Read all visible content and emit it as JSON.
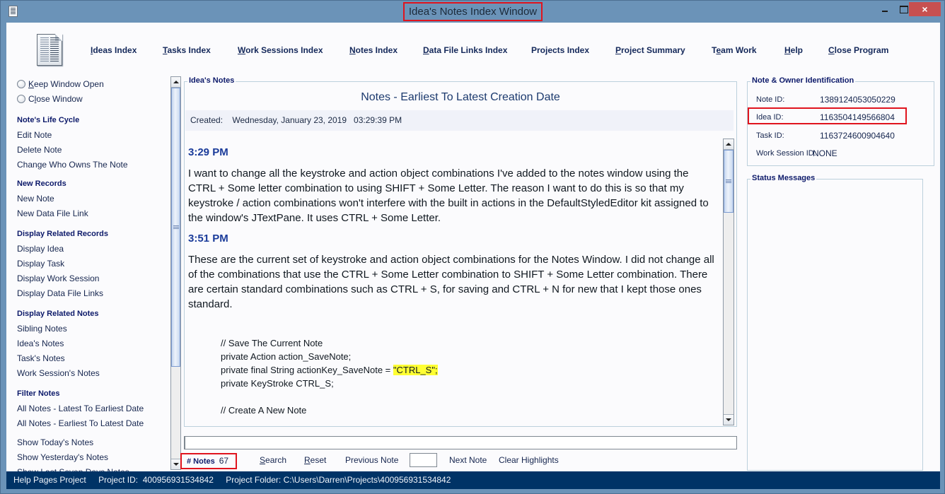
{
  "window": {
    "title": "Idea's Notes Index Window",
    "controls": {
      "minimize": "minimize",
      "maximize": "maximize",
      "close": "×"
    }
  },
  "menu": [
    {
      "label": "Ideas Index",
      "mnemonic": "I",
      "rest": "deas Index"
    },
    {
      "label": "Tasks Index",
      "mnemonic": "T",
      "rest": "asks Index"
    },
    {
      "label": "Work Sessions Index",
      "mnemonic": "W",
      "rest": "ork Sessions Index"
    },
    {
      "label": "Notes Index",
      "mnemonic": "N",
      "rest": "otes Index"
    },
    {
      "label": "Data File Links Index",
      "mnemonic": "D",
      "rest": "ata File Links Index"
    },
    {
      "label": "Projects Index",
      "mnemonic": "",
      "rest": "Projects Index"
    },
    {
      "label": "Project Summary",
      "mnemonic": "P",
      "rest": "roject Summary"
    },
    {
      "label": "Team Work",
      "pre": "T",
      "mnemonic": "e",
      "rest": "am Work"
    },
    {
      "label": "Help",
      "mnemonic": "H",
      "rest": "elp"
    },
    {
      "label": "Close Program",
      "mnemonic": "C",
      "rest": "lose Program"
    }
  ],
  "sidebar": {
    "radios": [
      {
        "label": "Keep Window Open",
        "mnemonic": "K",
        "rest": "eep Window Open"
      },
      {
        "label": "Close Window",
        "pre": "C",
        "mnemonic": "l",
        "rest": "ose Window"
      }
    ],
    "sections": [
      {
        "heading": "Note's Life Cycle",
        "items": [
          "Edit Note",
          "Delete Note",
          "Change Who Owns The Note"
        ]
      },
      {
        "heading": "New Records",
        "items": [
          "New Note",
          "New Data File Link"
        ]
      },
      {
        "heading": "Display Related Records",
        "items": [
          "Display Idea",
          "Display Task",
          "Display Work Session",
          "Display Data File Links"
        ]
      },
      {
        "heading": "Display Related Notes",
        "items": [
          "Sibling Notes",
          "Idea's Notes",
          "Task's Notes",
          "Work Session's Notes"
        ]
      },
      {
        "heading": "Filter Notes",
        "items": [
          "All Notes - Latest To Earliest Date",
          "All Notes - Earliest To Latest Date"
        ]
      }
    ],
    "extra_items": [
      "Show Today's Notes",
      "Show Yesterday's Notes",
      "Show Last Seven Days Notes"
    ]
  },
  "notes_panel": {
    "legend": "Idea's Notes",
    "heading": "Notes - Earliest To Latest Creation Date",
    "created_label": "Created:",
    "created_value": "Wednesday, January 23, 2019   03:29:39 PM",
    "entries": [
      {
        "time": "3:29 PM",
        "text": "I want to change all the keystroke and action object combinations I've added to the notes window using the CTRL + Some letter combination to using SHIFT + Some Letter. The reason I want to do this is so that my keystroke / action combinations won't interfere with the built in actions in the DefaultStyledEditor kit assigned to the window's JTextPane. It uses CTRL + Some Letter."
      },
      {
        "time": "3:51 PM",
        "text": "These are the current set of keystroke and action object combinations for the Notes Window. I did not change all of the combinations that use the CTRL + Some Letter combination to SHIFT + Some Letter combination. There are certain standard combinations such as CTRL + S, for saving and CTRL + N for new that I kept those ones standard."
      }
    ],
    "code": {
      "line1": "// Save The Current Note",
      "line2": "private Action action_SaveNote;",
      "line3_pre": "private final String actionKey_SaveNote = ",
      "line3_highlight": "\"CTRL_S\";",
      "line4": "private KeyStroke CTRL_S;",
      "line5": "// Create A New Note"
    }
  },
  "search": {
    "value": "",
    "notes_count_label": "# Notes",
    "notes_count": "67",
    "search_label": {
      "mnemonic": "S",
      "rest": "earch"
    },
    "reset_label": {
      "mnemonic": "R",
      "rest": "eset"
    },
    "previous_label": "Previous Note",
    "goto_value": "",
    "next_label": "Next Note",
    "clear_label": "Clear Highlights"
  },
  "identification": {
    "legend": "Note & Owner Identification",
    "rows": [
      {
        "label": "Note ID:",
        "value": "1389124053050229"
      },
      {
        "label": "Idea ID:",
        "value": "1163504149566804"
      },
      {
        "label": "Task ID:",
        "value": "1163724600904640"
      },
      {
        "label": "Work Session ID:",
        "value": "NONE"
      }
    ]
  },
  "status_messages": {
    "legend": "Status Messages",
    "messages": []
  },
  "statusbar": {
    "project_name": "Help Pages Project",
    "project_id": "Project ID:  400956931534842",
    "project_folder": "Project Folder: C:\\Users\\Darren\\Projects\\400956931534842"
  },
  "colors": {
    "highlight_box": "#e0141e",
    "statusbar_bg": "#003366",
    "frame": "#6b93b8",
    "heading_blue": "#0d1a6a",
    "code_highlight": "#ffff33"
  }
}
